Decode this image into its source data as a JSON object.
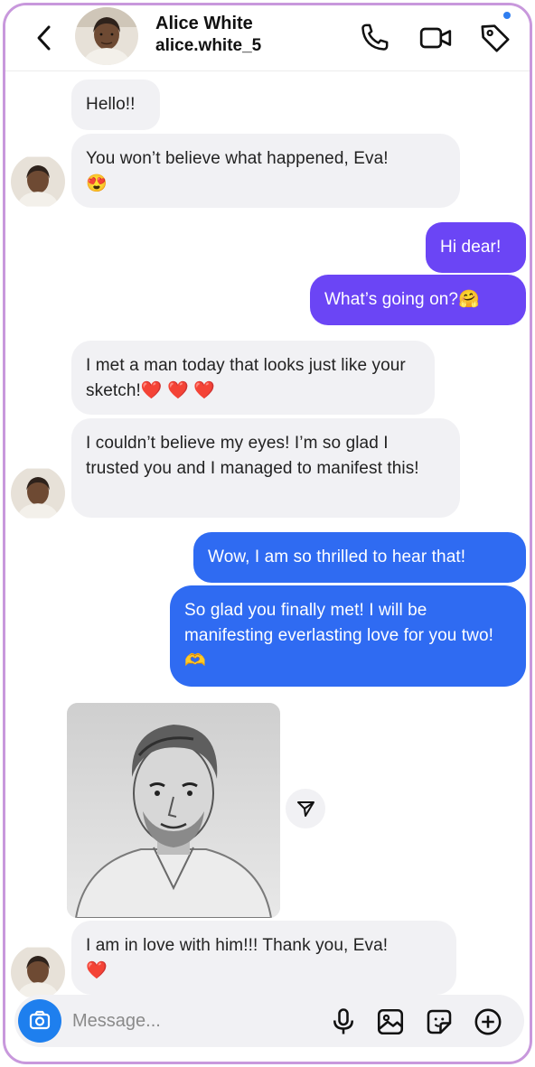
{
  "header": {
    "name": "Alice White",
    "username": "alice.white_5",
    "icons": [
      "back-icon",
      "phone-icon",
      "video-icon",
      "tag-icon"
    ],
    "accent": "#2f7ef0"
  },
  "messages": [
    {
      "from": "them",
      "text": "Hello!!"
    },
    {
      "from": "them",
      "text": "You won’t believe what happened, Eva!",
      "emoji": "😍"
    },
    {
      "from": "me",
      "text": "Hi dear!"
    },
    {
      "from": "me",
      "text": "What’s going on?",
      "emoji": "🤗"
    },
    {
      "from": "them",
      "text": "I met a man today that looks just like your sketch!",
      "emoji": "❤️ ❤️ ❤️"
    },
    {
      "from": "them",
      "text": "I couldn’t believe my eyes! I’m so glad I trusted you and I managed to manifest this!"
    },
    {
      "from": "me",
      "text": "Wow, I am so thrilled to hear that!"
    },
    {
      "from": "me",
      "text": "So glad you finally met! I will be manifesting everlasting love for you two!",
      "emoji": "🫶"
    },
    {
      "from": "them",
      "type": "image",
      "image": "portrait-sketch"
    },
    {
      "from": "them",
      "text": "I am in love with him!!! Thank you, Eva!",
      "emoji": "❤️"
    }
  ],
  "composer": {
    "placeholder": "Message...",
    "icons": [
      "camera-icon",
      "microphone-icon",
      "gallery-icon",
      "sticker-icon",
      "plus-icon"
    ]
  },
  "colors": {
    "outgoing_purple": "#6b45f5",
    "outgoing_blue": "#2f6bf2",
    "incoming": "#f1f1f4",
    "frame": "#c898dc"
  }
}
